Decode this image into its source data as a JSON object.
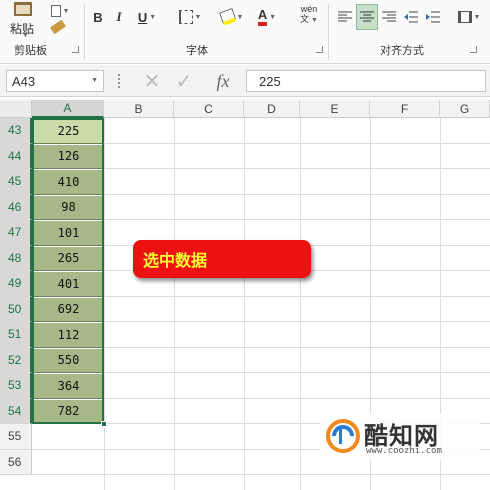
{
  "ribbon": {
    "clipboard": {
      "paste_label": "粘贴",
      "group_label": "剪贴板"
    },
    "font": {
      "bold": "B",
      "italic": "I",
      "underline": "U",
      "font_color_glyph": "A",
      "phonetic": "wén",
      "group_label": "字体"
    },
    "alignment": {
      "group_label": "对齐方式"
    }
  },
  "formula_bar": {
    "name_box": "A43",
    "fx_label": "fx",
    "formula_value": "225"
  },
  "columns": [
    "A",
    "B",
    "C",
    "D",
    "E",
    "F",
    "G"
  ],
  "rows": [
    "43",
    "44",
    "45",
    "46",
    "47",
    "48",
    "49",
    "50",
    "51",
    "52",
    "53",
    "54",
    "55",
    "56"
  ],
  "column_a_values": [
    "225",
    "126",
    "410",
    "98",
    "101",
    "265",
    "401",
    "692",
    "112",
    "550",
    "364",
    "782"
  ],
  "callout": {
    "text": "选中数据"
  },
  "watermark": {
    "name": "酷知网",
    "url": "www.coozhi.com"
  },
  "colors": {
    "selection_fill": "#a6b887",
    "active_cell_fill": "#c9dba8",
    "selection_border": "#217346",
    "callout_bg": "#ee1111",
    "callout_text": "#ffff33"
  }
}
